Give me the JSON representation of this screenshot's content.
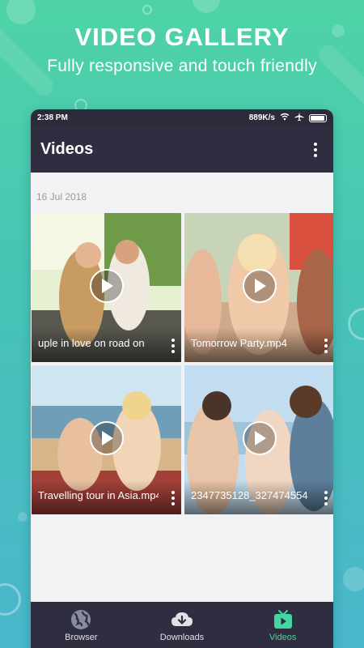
{
  "promo": {
    "title": "VIDEO GALLERY",
    "subtitle": "Fully responsive and touch friendly"
  },
  "status_bar": {
    "time": "2:38 PM",
    "speed": "889K/s"
  },
  "app_bar": {
    "title": "Videos",
    "menu_icon": "more-vertical-icon"
  },
  "gallery": {
    "date": "16 Jul 2018",
    "videos": [
      {
        "name": "uple in love on road on",
        "thumb_colors": [
          "#cfe7b5",
          "#6b8f4a",
          "#3a4a2a"
        ]
      },
      {
        "name": "Tomorrow Party.mp4",
        "thumb_colors": [
          "#d7c3a8",
          "#c9826b",
          "#6a4a3a"
        ]
      },
      {
        "name": "Travelling tour in Asia.mp4",
        "thumb_colors": [
          "#bfe0ee",
          "#d8b07a",
          "#8a3a3a"
        ]
      },
      {
        "name": "2347735128_327474554",
        "thumb_colors": [
          "#bcd8ee",
          "#e4c7a9",
          "#4a6a7a"
        ]
      }
    ]
  },
  "bottom_nav": {
    "items": [
      {
        "label": "Browser",
        "icon": "globe-icon",
        "active": false
      },
      {
        "label": "Downloads",
        "icon": "cloud-download-icon",
        "active": false
      },
      {
        "label": "Videos",
        "icon": "tv-play-icon",
        "active": true
      }
    ]
  },
  "colors": {
    "accent": "#43d6a0",
    "bar": "#2e2e40",
    "background_top": "#4fd3a6",
    "background_bottom": "#4ab6cc"
  }
}
